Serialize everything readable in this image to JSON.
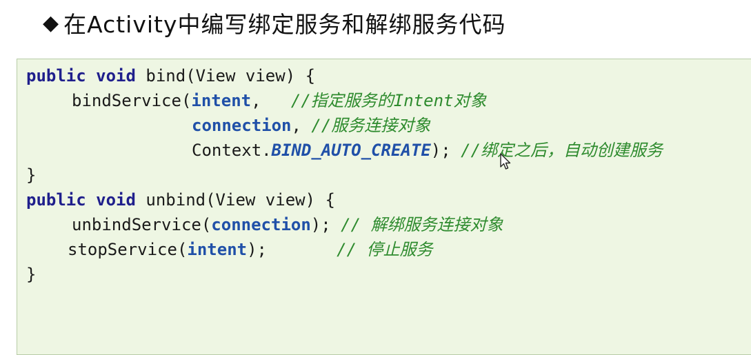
{
  "heading": {
    "bullet": "◆",
    "title": "在Activity中编写绑定服务和解绑服务代码"
  },
  "code": {
    "line1": {
      "kw1": "public",
      "kw2": "void",
      "rest": " bind(View view) {"
    },
    "line2": {
      "call": "bindService(",
      "arg": "intent",
      "sep": ",   ",
      "comment": "//指定服务的Intent对象"
    },
    "line3": {
      "arg": "connection",
      "sep": ", ",
      "comment": "//服务连接对象"
    },
    "line4": {
      "prefix": "Context.",
      "const": "BIND_AUTO_CREATE",
      "suffix": "); ",
      "comment": "//绑定之后，自动创建服务"
    },
    "line5": "}",
    "line6": {
      "kw1": "public",
      "kw2": "void",
      "rest": " unbind(View view) {"
    },
    "line7": {
      "call": "unbindService(",
      "arg": "connection",
      "suffix": "); ",
      "comment": "// 解绑服务连接对象"
    },
    "line8": {
      "call": "stopService(",
      "arg": "intent",
      "suffix": ");       ",
      "comment": "// 停止服务"
    },
    "line9": "}"
  }
}
